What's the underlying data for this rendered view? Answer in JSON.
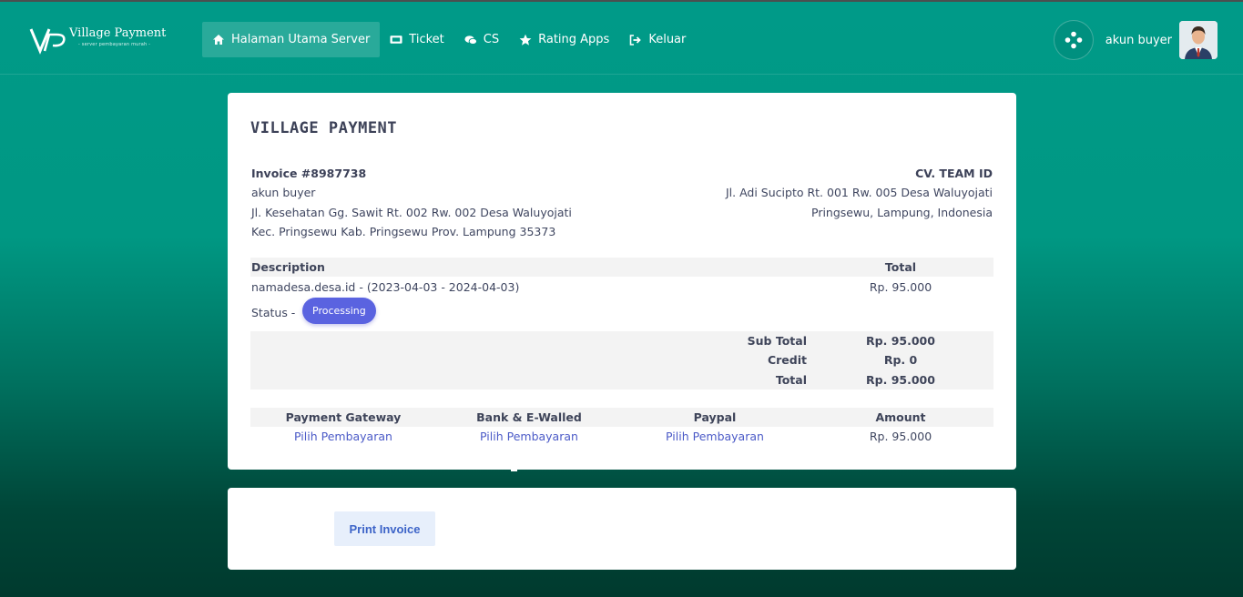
{
  "brand": {
    "name": "Village Payment",
    "tagline": "- server pembayaran murah -"
  },
  "nav": [
    {
      "label": "Halaman Utama Server",
      "icon": "home-icon",
      "active": true
    },
    {
      "label": "Ticket",
      "icon": "ticket-icon"
    },
    {
      "label": "CS",
      "icon": "chat-icon"
    },
    {
      "label": "Rating Apps",
      "icon": "star-icon"
    },
    {
      "label": "Keluar",
      "icon": "logout-icon"
    }
  ],
  "user": {
    "name": "akun buyer"
  },
  "invoice": {
    "company_title": "VILLAGE PAYMENT",
    "number_label": "Invoice #8987738",
    "customer_name": "akun buyer",
    "customer_addr1": "Jl. Kesehatan Gg. Sawit Rt. 002 Rw. 002 Desa Waluyojati",
    "customer_addr2": "Kec. Pringsewu Kab. Pringsewu Prov. Lampung 35373",
    "seller_name": "CV. TEAM ID",
    "seller_addr1": "Jl. Adi Sucipto Rt. 001 Rw. 005 Desa Waluyojati",
    "seller_addr2": "Pringsewu, Lampung, Indonesia",
    "table": {
      "col_description": "Description",
      "col_total": "Total",
      "item_desc": "namadesa.desa.id - (2023-04-03 - 2024-04-03)",
      "item_total": "Rp. 95.000",
      "status_label": "Status -",
      "status_badge": "Processing"
    },
    "totals": {
      "subtotal_label": "Sub Total",
      "subtotal_value": "Rp. 95.000",
      "credit_label": "Credit",
      "credit_value": "Rp. 0",
      "total_label": "Total",
      "total_value": "Rp. 95.000"
    },
    "payment": {
      "headers": [
        "Payment Gateway",
        "Bank & E-Walled",
        "Paypal",
        "Amount"
      ],
      "gateway_link": "Pilih Pembayaran",
      "bank_link": "Pilih Pembayaran",
      "paypal_link": "Pilih Pembayaran",
      "amount": "Rp. 95.000"
    }
  },
  "actions": {
    "print_label": "Print Invoice"
  },
  "colors": {
    "accent": "#009a88",
    "badge": "#5a63e0",
    "link": "#4b5ac7"
  }
}
